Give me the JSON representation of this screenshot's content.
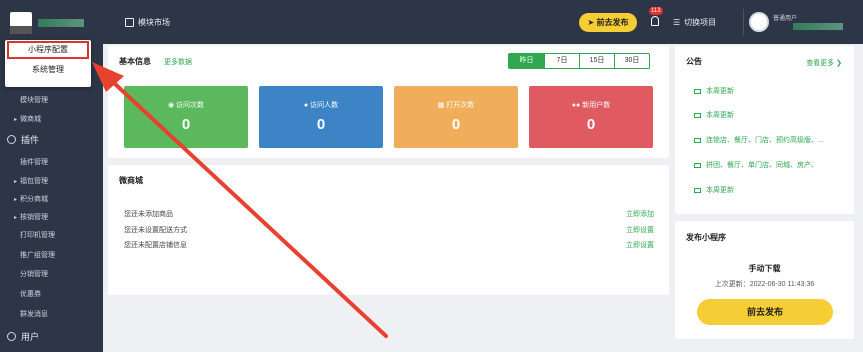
{
  "sidebar": {
    "popup": [
      "小程序配置",
      "系统管理"
    ],
    "items": [
      {
        "label": "模块管理",
        "arrow": false
      },
      {
        "label": "微商城",
        "arrow": true
      },
      {
        "label": "插件管理",
        "arrow": false
      },
      {
        "label": "福包管理",
        "arrow": true
      },
      {
        "label": "积分商城",
        "arrow": true
      },
      {
        "label": "核销管理",
        "arrow": true
      },
      {
        "label": "打印机管理",
        "arrow": false
      },
      {
        "label": "推广组管理",
        "arrow": false
      },
      {
        "label": "分销管理",
        "arrow": false
      },
      {
        "label": "优惠券",
        "arrow": false
      },
      {
        "label": "群发消息",
        "arrow": false
      }
    ],
    "sections": {
      "plugins": "插件",
      "users": "用户"
    }
  },
  "topbar": {
    "market": "模块市场",
    "publish": "前去发布",
    "badge": "113",
    "switch": "切换项目",
    "role": "普通用户"
  },
  "basic": {
    "title": "基本信息",
    "more": "更多数据",
    "date_tabs": [
      "昨日",
      "7日",
      "15日",
      "30日"
    ],
    "stats": [
      {
        "label": "访问次数",
        "value": "0",
        "color": "#5cb85c"
      },
      {
        "label": "访问人数",
        "value": "0",
        "color": "#3d84c6"
      },
      {
        "label": "打开次数",
        "value": "0",
        "color": "#f0ad5a"
      },
      {
        "label": "新用户数",
        "value": "0",
        "color": "#e05a62"
      }
    ]
  },
  "mall": {
    "title": "微商城",
    "rows": [
      {
        "text": "您还未添加商品",
        "action": "立即添加"
      },
      {
        "text": "您还未设置配送方式",
        "action": "立即设置"
      },
      {
        "text": "您还未配置店铺信息",
        "action": "立即设置"
      }
    ]
  },
  "notice": {
    "title": "公告",
    "more": "查看更多 ❯",
    "items": [
      "本周更新",
      "本周更新",
      "连锁店、餐厅、门店、预约高级版、...",
      "拼团、餐厅、单门店、同城、房产、",
      "本周更新"
    ]
  },
  "release": {
    "title": "发布小程序",
    "manual": "手动下载",
    "updated": "上次更新：2022-06-30 11:43:36",
    "button": "前去发布"
  }
}
